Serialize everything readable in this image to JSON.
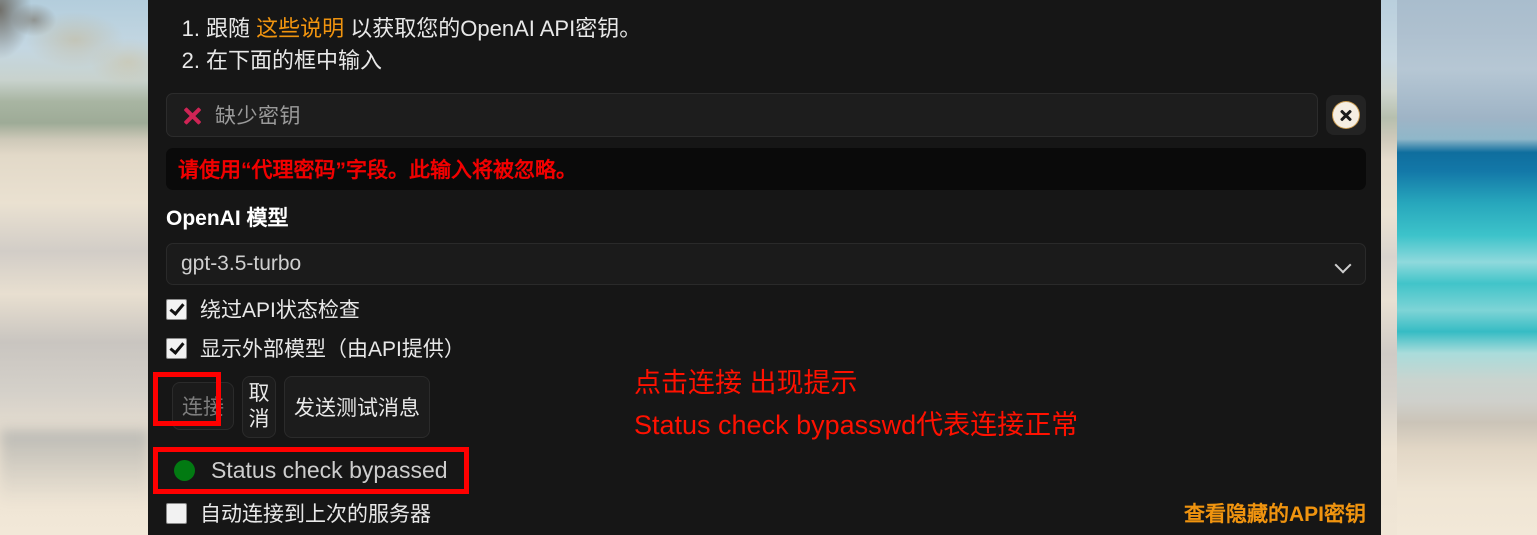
{
  "instructions": {
    "items": [
      {
        "num": "1.",
        "prefix": "跟随 ",
        "link": "这些说明",
        "suffix": " 以获取您的OpenAI API密钥。"
      },
      {
        "num": "2.",
        "prefix": "在下面的框中输入",
        "link": "",
        "suffix": ""
      }
    ]
  },
  "api_key": {
    "status_icon": "x-mark-icon",
    "placeholder": "缺少密钥",
    "value": "",
    "clear_icon": "circle-x-icon"
  },
  "warning": {
    "text": "请使用“代理密码”字段。此输入将被忽略。",
    "color": "#f20000"
  },
  "model_section": {
    "label": "OpenAI 模型",
    "selected": "gpt-3.5-turbo",
    "chevron_icon": "chevron-down-icon"
  },
  "options": [
    {
      "label": "绕过API状态检查",
      "checked": true
    },
    {
      "label": "显示外部模型（由API提供）",
      "checked": true
    }
  ],
  "buttons": {
    "connect": "连接",
    "cancel": "取消",
    "test": "发送测试消息"
  },
  "status": {
    "text": "Status check bypassed",
    "dot_color": "#027a12"
  },
  "footer": {
    "autoconnect_label": "自动连接到上次的服务器",
    "autoconnect_checked": false,
    "view_key_link": "查看隐藏的API密钥",
    "link_color": "#f0940f"
  },
  "annotation": {
    "line1": "点击连接 出现提示",
    "line2": "Status check bypasswd代表连接正常",
    "color": "#ff1100"
  },
  "scrollbar": {
    "thumb_color": "#8a8a8a"
  }
}
